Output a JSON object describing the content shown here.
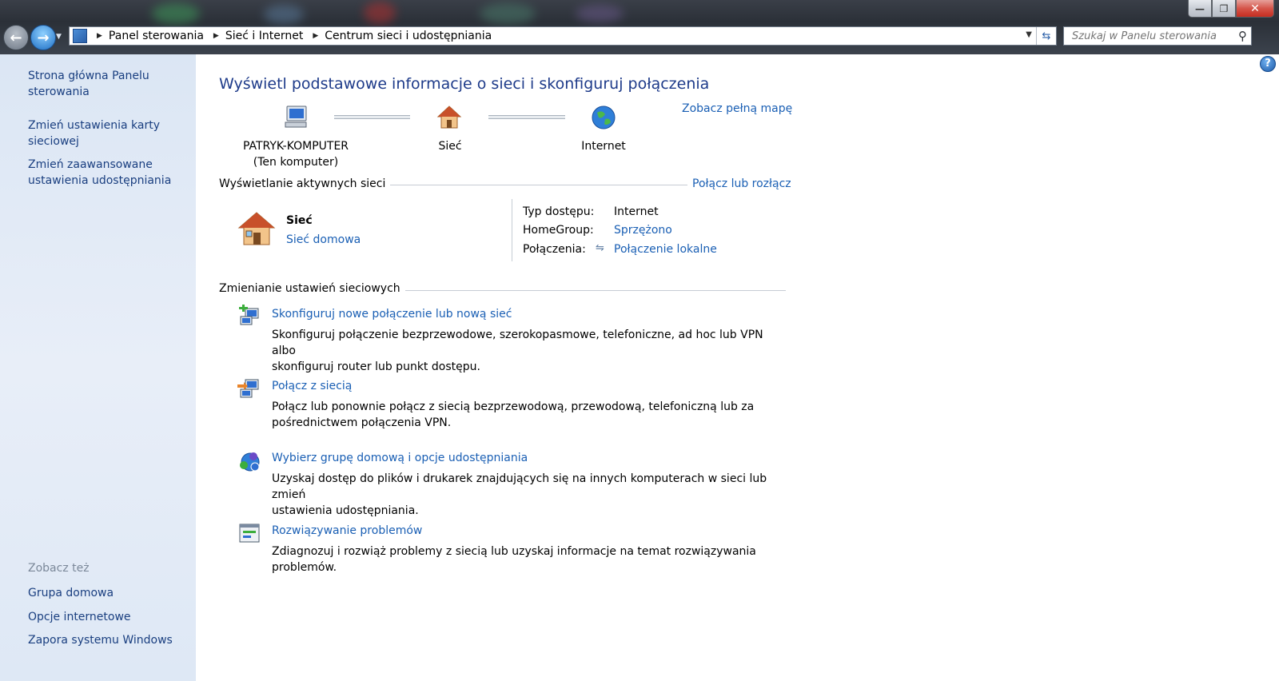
{
  "window": {
    "buttons": {
      "minimize": "—",
      "maximize": "❐",
      "close": "✕"
    }
  },
  "address_bar": {
    "crumbs": [
      "Panel sterowania",
      "Sieć i Internet",
      "Centrum sieci i udostępniania"
    ]
  },
  "search": {
    "placeholder": "Szukaj w Panelu sterowania"
  },
  "sidebar": {
    "links": [
      {
        "label": "Strona główna Panelu sterowania"
      },
      {
        "label": "Zmień ustawienia karty sieciowej"
      },
      {
        "label": "Zmień zaawansowane ustawienia udostępniania"
      }
    ],
    "see_also_heading": "Zobacz też",
    "see_also": [
      {
        "label": "Grupa domowa"
      },
      {
        "label": "Opcje internetowe"
      },
      {
        "label": "Zapora systemu Windows"
      }
    ]
  },
  "main": {
    "title": "Wyświetl podstawowe informacje o sieci i skonfiguruj połączenia",
    "full_map_link": "Zobacz pełną mapę",
    "map": {
      "computer_name": "PATRYK-KOMPUTER",
      "computer_sub": "(Ten komputer)",
      "network": "Sieć",
      "internet": "Internet"
    },
    "active_networks": {
      "heading": "Wyświetlanie aktywnych sieci",
      "connect_link": "Połącz lub rozłącz",
      "network_name": "Sieć",
      "network_type": "Sieć domowa",
      "access_type_label": "Typ dostępu:",
      "access_type_value": "Internet",
      "homegroup_label": "HomeGroup:",
      "homegroup_value": "Sprzężono",
      "connections_label": "Połączenia:",
      "connections_value": "Połączenie lokalne"
    },
    "change_settings": {
      "heading": "Zmienianie ustawień sieciowych",
      "tasks": [
        {
          "title": "Skonfiguruj nowe połączenie lub nową sieć",
          "desc_line1": "Skonfiguruj połączenie bezprzewodowe, szerokopasmowe, telefoniczne, ad hoc lub VPN albo",
          "desc_line2": "skonfiguruj router lub punkt dostępu."
        },
        {
          "title": "Połącz z siecią",
          "desc_line1": "Połącz lub ponownie połącz z siecią bezprzewodową, przewodową, telefoniczną lub za",
          "desc_line2": "pośrednictwem połączenia VPN."
        },
        {
          "title": "Wybierz grupę domową i opcje udostępniania",
          "desc_line1": "Uzyskaj dostęp do plików i drukarek znajdujących się na innych komputerach w sieci lub zmień",
          "desc_line2": "ustawienia udostępniania."
        },
        {
          "title": "Rozwiązywanie problemów",
          "desc_line1": "Zdiagnozuj i rozwiąż problemy z siecią lub uzyskaj informacje na temat rozwiązywania",
          "desc_line2": "problemów."
        }
      ]
    }
  },
  "help_symbol": "?"
}
